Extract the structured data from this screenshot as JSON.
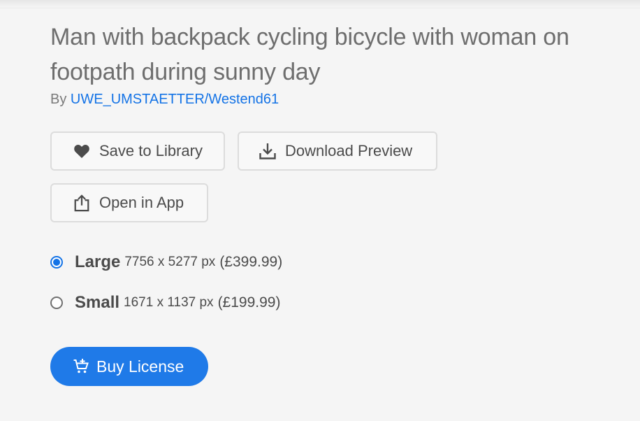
{
  "asset": {
    "title": "Man with backpack cycling bicycle with woman on footpath during sunny day",
    "by_prefix": "By",
    "author": "UWE_UMSTAETTER/Westend61"
  },
  "actions": {
    "save_label": "Save to Library",
    "download_label": "Download Preview",
    "open_label": "Open in App"
  },
  "license_options": [
    {
      "name": "Large",
      "dimensions": "7756 x 5277 px",
      "price": "(£399.99)",
      "selected": true
    },
    {
      "name": "Small",
      "dimensions": "1671 x 1137 px",
      "price": "(£199.99)",
      "selected": false
    }
  ],
  "buy": {
    "label": "Buy License"
  },
  "icons": {
    "save": "heart-icon",
    "download": "download-icon",
    "open": "share-icon",
    "buy": "cart-add-icon"
  },
  "colors": {
    "accent": "#1473e6",
    "button_blue": "#1f7ae8",
    "background": "#f5f5f5"
  }
}
